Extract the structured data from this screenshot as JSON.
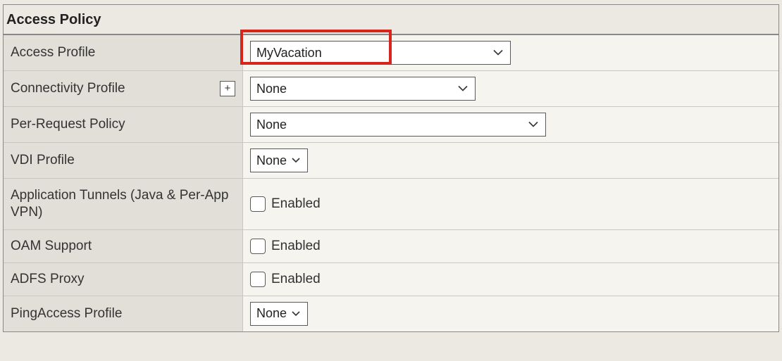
{
  "panel": {
    "title": "Access Policy"
  },
  "rows": {
    "access_profile": {
      "label": "Access Profile",
      "value": "MyVacation"
    },
    "connectivity_profile": {
      "label": "Connectivity Profile",
      "value": "None",
      "plus": "+"
    },
    "per_request_policy": {
      "label": "Per-Request Policy",
      "value": "None"
    },
    "vdi_profile": {
      "label": "VDI Profile",
      "value": "None"
    },
    "app_tunnels": {
      "label": "Application Tunnels (Java & Per-App VPN)",
      "value": "Enabled"
    },
    "oam_support": {
      "label": "OAM Support",
      "value": "Enabled"
    },
    "adfs_proxy": {
      "label": "ADFS Proxy",
      "value": "Enabled"
    },
    "pingaccess_profile": {
      "label": "PingAccess Profile",
      "value": "None"
    }
  }
}
